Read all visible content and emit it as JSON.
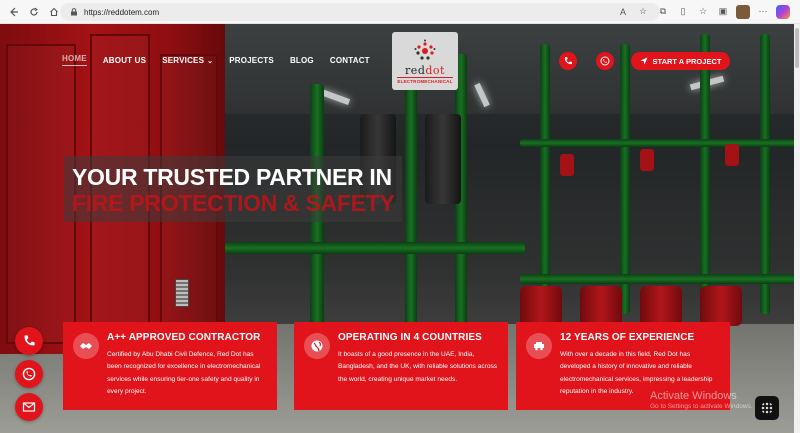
{
  "browser": {
    "url": "https://reddotem.com",
    "back_icon": "arrow-left-icon",
    "refresh_icon": "refresh-icon",
    "home_icon": "home-icon"
  },
  "nav": {
    "items": [
      {
        "label": "HOME"
      },
      {
        "label": "ABOUT US"
      },
      {
        "label": "SERVICES"
      },
      {
        "label": "PROJECTS"
      },
      {
        "label": "BLOG"
      },
      {
        "label": "CONTACT"
      }
    ]
  },
  "logo": {
    "text_a": "red",
    "text_b": "dot",
    "subtitle": "ELECTROMECHANICAL"
  },
  "cta": {
    "label": "START A PROJECT"
  },
  "hero": {
    "line1": "YOUR TRUSTED PARTNER IN",
    "line2": "FIRE PROTECTION & SAFETY"
  },
  "cards": [
    {
      "title": "A++ APPROVED CONTRACTOR",
      "body": "Certified by Abu Dhabi Civil Defence, Red Dot has been recognized for excellence in electromechanical services while ensuring tier-one safety and quality in every project.",
      "icon": "handshake-icon"
    },
    {
      "title": "OPERATING IN 4 COUNTRIES",
      "body": "It boasts of a good presence in the UAE, India, Bangladesh, and the UK, with reliable solutions across the world, creating unique market needs.",
      "icon": "globe-icon"
    },
    {
      "title": "12 YEARS OF EXPERIENCE",
      "body": "With over a decade in this field, Red Dot has developed a history of innovative and reliable electromechanical services, impressing a leadership reputation in the industry.",
      "icon": "truck-icon"
    }
  ],
  "watermark": {
    "line1": "Activate Windows",
    "line2": "Go to Settings to activate Windows."
  },
  "colors": {
    "accent": "#e1141b"
  }
}
